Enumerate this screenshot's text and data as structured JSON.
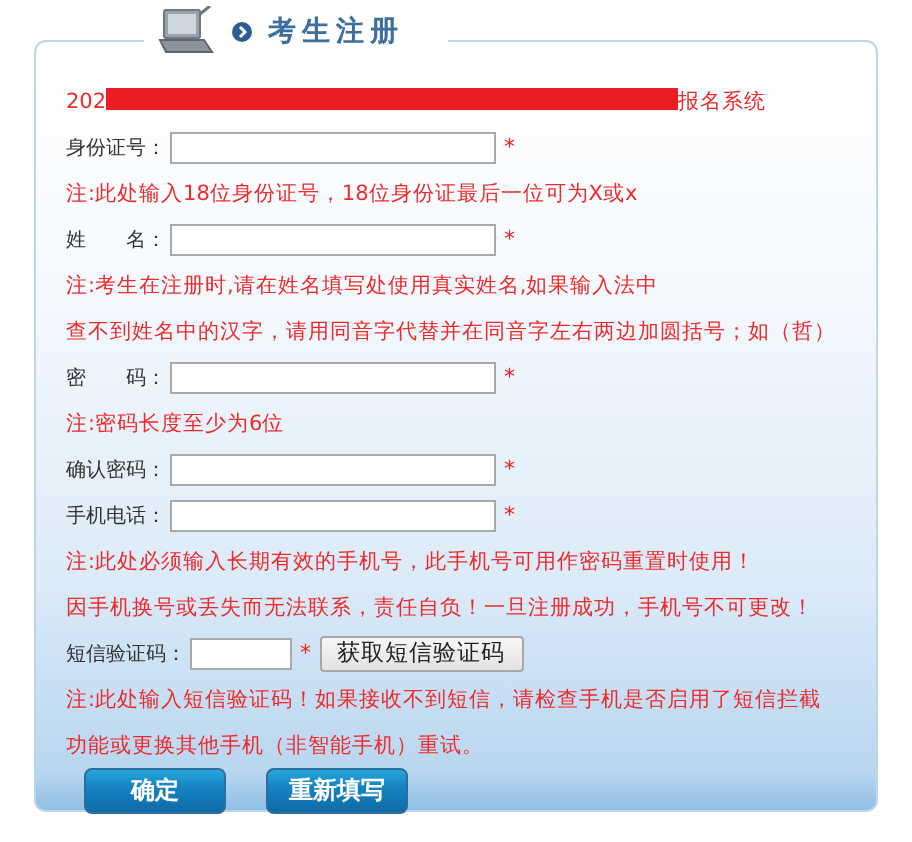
{
  "header": {
    "title": "考生注册"
  },
  "system_title": {
    "prefix": "202",
    "suffix": "报名系统"
  },
  "items": [
    {
      "kind": "field",
      "label": "身份证号：",
      "marker": "*"
    },
    {
      "kind": "note",
      "text": "注:此处输入18位身份证号，18位身份证最后一位可为X或x"
    },
    {
      "kind": "field",
      "label": "姓　　名：",
      "marker": "*"
    },
    {
      "kind": "note",
      "text": "注:考生在注册时,请在姓名填写处使用真实姓名,如果输入法中"
    },
    {
      "kind": "note",
      "text": "查不到姓名中的汉字，请用同音字代替并在同音字左右两边加圆括号；如（哲）"
    },
    {
      "kind": "field",
      "label": "密　　码：",
      "marker": "*"
    },
    {
      "kind": "note",
      "text": "注:密码长度至少为6位"
    },
    {
      "kind": "field",
      "label": "确认密码：",
      "marker": "*"
    },
    {
      "kind": "field",
      "label": "手机电话：",
      "marker": "*"
    },
    {
      "kind": "note",
      "text": "注:此处必须输入长期有效的手机号，此手机号可用作密码重置时使用！"
    },
    {
      "kind": "note",
      "text": "因手机换号或丢失而无法联系，责任自负！一旦注册成功，手机号不可更改！"
    },
    {
      "kind": "sms",
      "label": "短信验证码：",
      "marker": "*",
      "button": "获取短信验证码"
    },
    {
      "kind": "note",
      "text": "注:此处输入短信验证码！如果接收不到短信，请检查手机是否启用了短信拦截"
    },
    {
      "kind": "note",
      "text": "功能或更换其他手机（非智能手机）重试。"
    }
  ],
  "buttons": [
    "确定",
    "重新填写"
  ]
}
